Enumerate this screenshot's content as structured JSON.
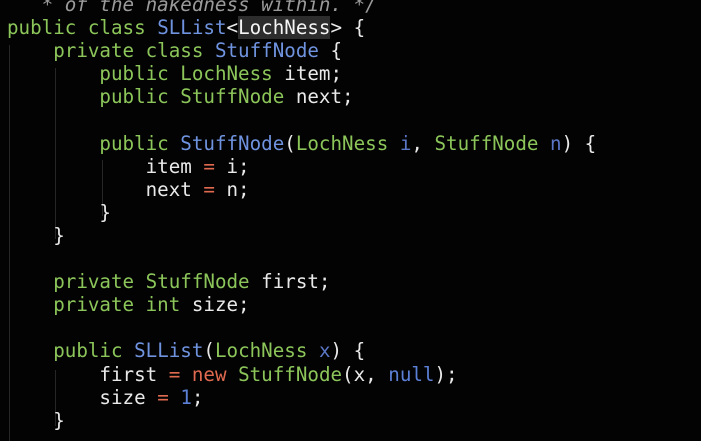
{
  "editor": {
    "lines": [
      {
        "tokens": [
          {
            "t": "cm",
            "v": "   * of the nakedness within. */"
          }
        ]
      },
      {
        "tokens": [
          {
            "t": "kw",
            "v": "public class "
          },
          {
            "t": "fn",
            "v": "SLList"
          },
          {
            "t": "plain",
            "v": "<"
          },
          {
            "t": "hl",
            "v": "LochNess"
          },
          {
            "t": "plain",
            "v": "> {"
          }
        ]
      },
      {
        "tokens": [
          {
            "t": "plain",
            "v": "    "
          },
          {
            "t": "kw",
            "v": "private class "
          },
          {
            "t": "fn",
            "v": "StuffNode"
          },
          {
            "t": "plain",
            "v": " {"
          }
        ]
      },
      {
        "tokens": [
          {
            "t": "plain",
            "v": "        "
          },
          {
            "t": "kw",
            "v": "public "
          },
          {
            "t": "kw",
            "v": "LochNess"
          },
          {
            "t": "plain",
            "v": " item;"
          }
        ]
      },
      {
        "tokens": [
          {
            "t": "plain",
            "v": "        "
          },
          {
            "t": "kw",
            "v": "public "
          },
          {
            "t": "kw",
            "v": "StuffNode"
          },
          {
            "t": "plain",
            "v": " next;"
          }
        ]
      },
      {
        "tokens": [
          {
            "t": "plain",
            "v": ""
          }
        ]
      },
      {
        "tokens": [
          {
            "t": "plain",
            "v": "        "
          },
          {
            "t": "kw",
            "v": "public "
          },
          {
            "t": "fn",
            "v": "StuffNode"
          },
          {
            "t": "plain",
            "v": "("
          },
          {
            "t": "kw",
            "v": "LochNess"
          },
          {
            "t": "plain",
            "v": " "
          },
          {
            "t": "param",
            "v": "i"
          },
          {
            "t": "plain",
            "v": ", "
          },
          {
            "t": "kw",
            "v": "StuffNode"
          },
          {
            "t": "plain",
            "v": " "
          },
          {
            "t": "param",
            "v": "n"
          },
          {
            "t": "plain",
            "v": ") {"
          }
        ]
      },
      {
        "tokens": [
          {
            "t": "plain",
            "v": "            item "
          },
          {
            "t": "op",
            "v": "="
          },
          {
            "t": "plain",
            "v": " i;"
          }
        ]
      },
      {
        "tokens": [
          {
            "t": "plain",
            "v": "            next "
          },
          {
            "t": "op",
            "v": "="
          },
          {
            "t": "plain",
            "v": " n;"
          }
        ]
      },
      {
        "tokens": [
          {
            "t": "plain",
            "v": "        }"
          }
        ]
      },
      {
        "tokens": [
          {
            "t": "plain",
            "v": "    }"
          }
        ]
      },
      {
        "tokens": [
          {
            "t": "plain",
            "v": ""
          }
        ]
      },
      {
        "tokens": [
          {
            "t": "plain",
            "v": "    "
          },
          {
            "t": "kw",
            "v": "private "
          },
          {
            "t": "kw",
            "v": "StuffNode"
          },
          {
            "t": "plain",
            "v": " first;"
          }
        ]
      },
      {
        "tokens": [
          {
            "t": "plain",
            "v": "    "
          },
          {
            "t": "kw",
            "v": "private int"
          },
          {
            "t": "plain",
            "v": " size;"
          }
        ]
      },
      {
        "tokens": [
          {
            "t": "plain",
            "v": ""
          }
        ]
      },
      {
        "tokens": [
          {
            "t": "plain",
            "v": "    "
          },
          {
            "t": "kw",
            "v": "public "
          },
          {
            "t": "fn",
            "v": "SLList"
          },
          {
            "t": "plain",
            "v": "("
          },
          {
            "t": "kw",
            "v": "LochNess"
          },
          {
            "t": "plain",
            "v": " "
          },
          {
            "t": "param",
            "v": "x"
          },
          {
            "t": "plain",
            "v": ") {"
          }
        ]
      },
      {
        "tokens": [
          {
            "t": "plain",
            "v": "        first "
          },
          {
            "t": "op",
            "v": "="
          },
          {
            "t": "plain",
            "v": " "
          },
          {
            "t": "op",
            "v": "new"
          },
          {
            "t": "plain",
            "v": " "
          },
          {
            "t": "kw",
            "v": "StuffNode"
          },
          {
            "t": "plain",
            "v": "(x, "
          },
          {
            "t": "num",
            "v": "null"
          },
          {
            "t": "plain",
            "v": ");"
          }
        ]
      },
      {
        "tokens": [
          {
            "t": "plain",
            "v": "        size "
          },
          {
            "t": "op",
            "v": "="
          },
          {
            "t": "plain",
            "v": " "
          },
          {
            "t": "num",
            "v": "1"
          },
          {
            "t": "plain",
            "v": ";"
          }
        ]
      },
      {
        "tokens": [
          {
            "t": "plain",
            "v": "    }"
          }
        ]
      }
    ]
  },
  "colors": {
    "background": "#030303",
    "keyword": "#8cc65a",
    "function": "#6f93df",
    "parameter": "#5b76c6",
    "operator": "#e06a4f",
    "literal": "#5c80d6",
    "comment": "#9a9a9a",
    "text": "#e9e9e9",
    "highlight": "#2d2d2d"
  }
}
